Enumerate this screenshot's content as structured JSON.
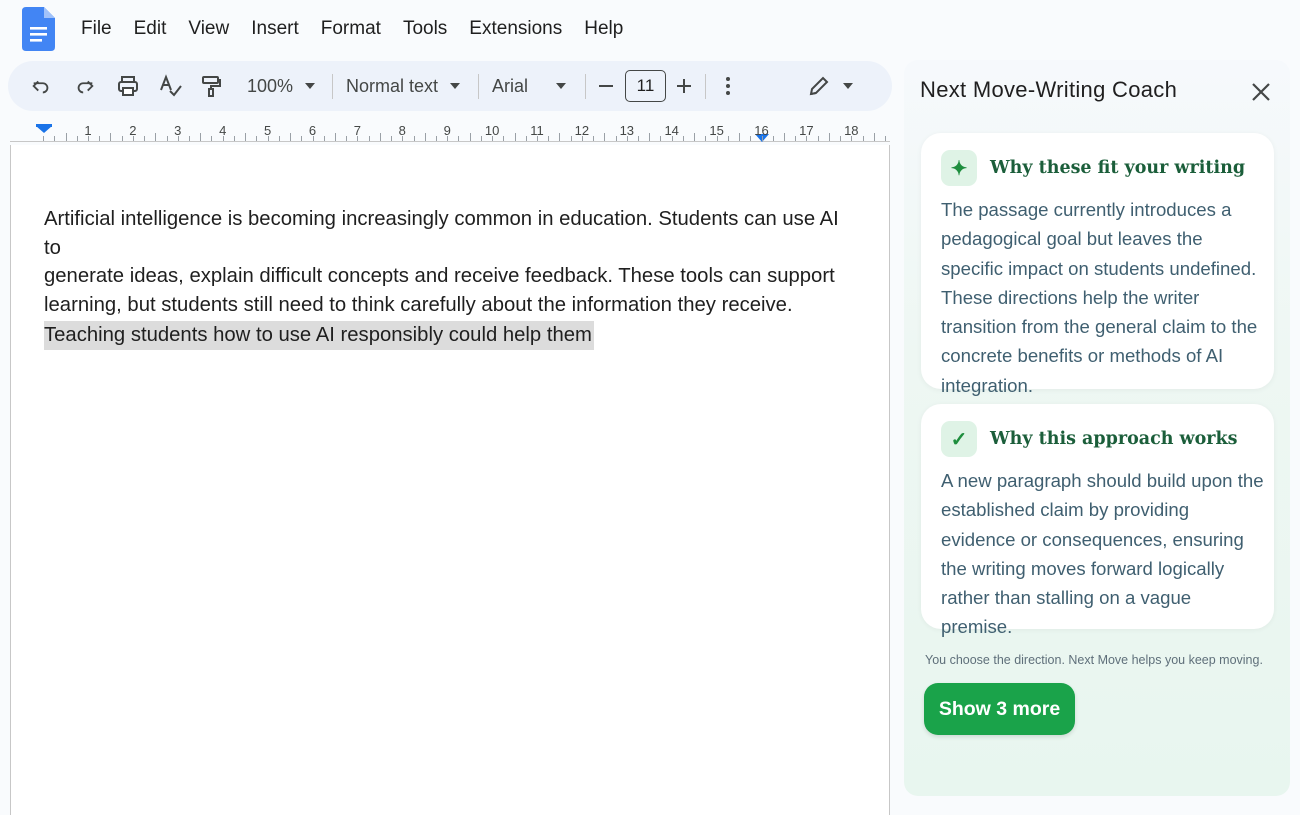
{
  "menu": {
    "items": [
      "File",
      "Edit",
      "View",
      "Insert",
      "Format",
      "Tools",
      "Extensions",
      "Help"
    ]
  },
  "toolbar": {
    "zoom": "100%",
    "style": "Normal text",
    "font": "Arial",
    "font_size": "11",
    "icons": [
      "undo-icon",
      "redo-icon",
      "print-icon",
      "spellcheck-icon",
      "paint-format-icon",
      "minus-icon",
      "plus-icon",
      "more-vert-icon",
      "pen-edit-icon"
    ]
  },
  "ruler": {
    "numbers": [
      "1",
      "2",
      "3",
      "4",
      "5",
      "6",
      "7",
      "8",
      "9",
      "10",
      "11",
      "12",
      "13",
      "14",
      "15",
      "16",
      "17",
      "18"
    ]
  },
  "document": {
    "paragraph_lines": [
      "Artificial intelligence is becoming increasingly common in education. Students can use AI to",
      "generate ideas, explain difficult concepts and receive feedback. These tools can support",
      "learning, but students still need to think carefully about the information they receive."
    ],
    "highlighted_line": "Teaching students how to use AI responsibly could help them"
  },
  "panel": {
    "title": "Next Move-Writing Coach",
    "cards": [
      {
        "icon": "sparkle-icon",
        "title": "Why these fit your writing",
        "body": "The passage currently introduces a pedagogical goal but leaves the specific impact on students undefined. These directions help the writer transition from the general claim to the concrete benefits or methods of AI integration."
      },
      {
        "icon": "check-icon",
        "title": "Why this approach works",
        "body": "A new paragraph should build upon the established claim by providing evidence or consequences, ensuring the writing moves forward logically rather than stalling on a vague premise."
      }
    ],
    "note": "You choose the direction. Next Move helps you keep moving.",
    "button_label": "Show 3 more"
  },
  "colors": {
    "accent_green": "#1aa34a",
    "card_title_green": "#1b5e3a",
    "docs_blue": "#4285f4",
    "highlight_gray": "#dcdcdc"
  }
}
